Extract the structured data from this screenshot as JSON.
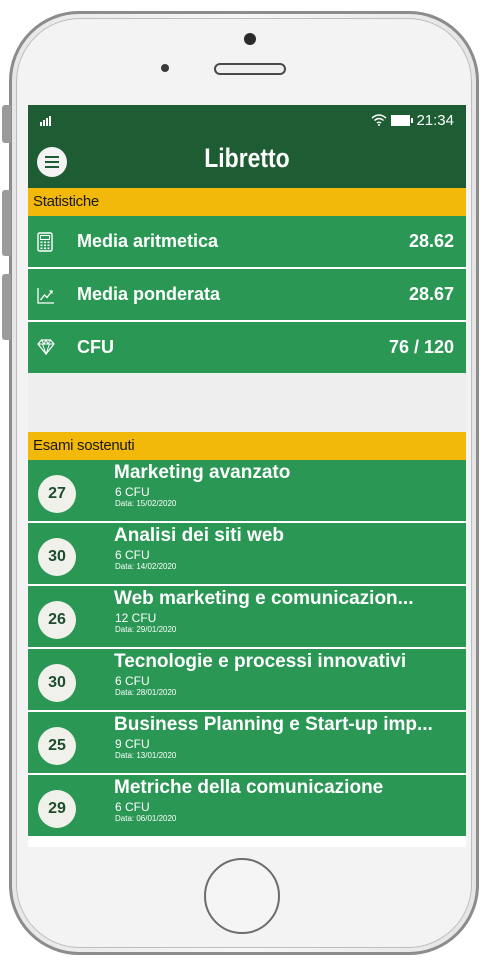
{
  "statusbar": {
    "time": "21:34"
  },
  "appbar": {
    "title": "Libretto"
  },
  "stats_section": {
    "header": "Statistiche",
    "items": [
      {
        "icon": "calculator-icon",
        "label": "Media aritmetica",
        "value": "28.62"
      },
      {
        "icon": "chart-line-icon",
        "label": "Media ponderata",
        "value": "28.67"
      },
      {
        "icon": "diamond-icon",
        "label": "CFU",
        "value": "76 / 120"
      }
    ]
  },
  "exams_section": {
    "header": "Esami sostenuti",
    "items": [
      {
        "grade": "27",
        "name": "Marketing avanzato",
        "cfu": "6 CFU",
        "date": "Data: 15/02/2020"
      },
      {
        "grade": "30",
        "name": "Analisi dei siti web",
        "cfu": "6 CFU",
        "date": "Data: 14/02/2020"
      },
      {
        "grade": "26",
        "name": "Web marketing e comunicazion...",
        "cfu": "12 CFU",
        "date": "Data: 29/01/2020"
      },
      {
        "grade": "30",
        "name": "Tecnologie e processi innovativi",
        "cfu": "6 CFU",
        "date": "Data: 28/01/2020"
      },
      {
        "grade": "25",
        "name": "Business Planning e Start-up imp...",
        "cfu": "9 CFU",
        "date": "Data: 13/01/2020"
      },
      {
        "grade": "29",
        "name": "Metriche della comunicazione",
        "cfu": "6 CFU",
        "date": "Data: 06/01/2020"
      }
    ]
  },
  "colors": {
    "primary_dark": "#1e5d34",
    "primary": "#2a9754",
    "accent": "#f2b90a"
  }
}
